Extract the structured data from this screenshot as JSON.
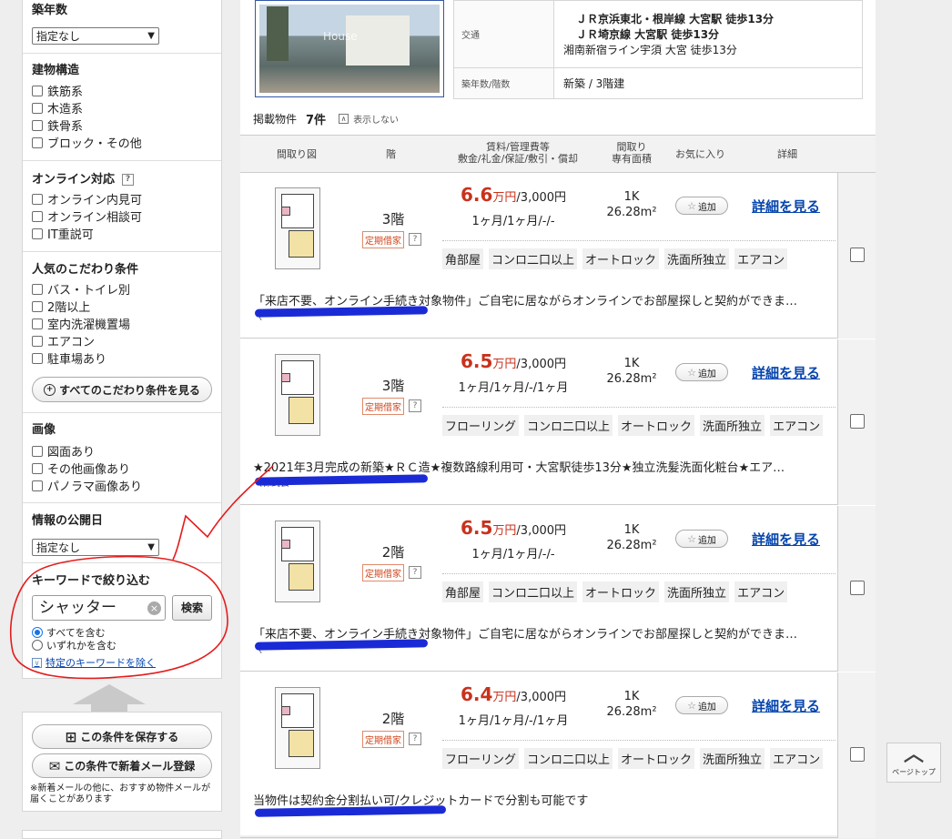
{
  "sidebar": {
    "age": {
      "title": "築年数",
      "select": "指定なし"
    },
    "structure": {
      "title": "建物構造",
      "items": [
        "鉄筋系",
        "木造系",
        "鉄骨系",
        "ブロック・その他"
      ]
    },
    "online": {
      "title": "オンライン対応",
      "help": "?",
      "items": [
        "オンライン内見可",
        "オンライン相談可",
        "IT重説可"
      ]
    },
    "popular": {
      "title": "人気のこだわり条件",
      "items": [
        "バス・トイレ別",
        "2階以上",
        "室内洗濯機置場",
        "エアコン",
        "駐車場あり"
      ],
      "more_button": "すべてのこだわり条件を見る"
    },
    "images": {
      "title": "画像",
      "items": [
        "図面あり",
        "その他画像あり",
        "パノラマ画像あり"
      ]
    },
    "published": {
      "title": "情報の公開日",
      "select": "指定なし"
    },
    "keyword": {
      "title": "キーワードで絞り込む",
      "value": "シャッター",
      "search_button": "検索",
      "radio_all": "すべてを含む",
      "radio_any": "いずれかを含む",
      "exclude_link": "特定のキーワードを除く"
    },
    "save": {
      "save_button": "この条件を保存する",
      "mail_button": "この条件で新着メール登録",
      "note": "※新着メールの他に、おすすめ物件メールが届くことがあります"
    }
  },
  "property": {
    "thumb_watermark": "House",
    "access_label": "交通",
    "access_lines": [
      "ＪＲ京浜東北・根岸線 大宮駅 徒歩13分",
      "ＪＲ埼京線 大宮駅 徒歩13分",
      "湘南新宿ライン宇須 大宮 徒歩13分"
    ],
    "age_label": "築年数/階数",
    "age_value": "新築 / 3階建"
  },
  "listing": {
    "count_label": "掲載物件",
    "count_value": "7件",
    "toggle_label": "表示しない",
    "headers": {
      "floorplan": "間取り図",
      "floor": "階",
      "rent_line1": "賃料/管理費等",
      "rent_line2": "敷金/礼金/保証/敷引・償却",
      "layout_line1": "間取り",
      "layout_line2": "専有面積",
      "favorite": "お気に入り",
      "detail": "詳細"
    },
    "rows": [
      {
        "floor": "3階",
        "tag": "定期借家",
        "rent": "6.6",
        "rent_unit": "万円",
        "mgmt": "/3,000円",
        "deposit": "1ヶ月/1ヶ月/-/-",
        "layout": "1K",
        "area": "26.28m²",
        "fav": "追加",
        "detail": "詳細を見る",
        "features": [
          "角部屋",
          "コンロ二口以上",
          "オートロック",
          "洗面所独立",
          "エアコン"
        ],
        "desc": "「来店不要、オンライン手続き対象物件」ご自宅に居ながらオンラインでお部屋探しと契約ができま…",
        "company": "（"
      },
      {
        "floor": "3階",
        "tag": "定期借家",
        "rent": "6.5",
        "rent_unit": "万円",
        "mgmt": "/3,000円",
        "deposit": "1ヶ月/1ヶ月/-/1ヶ月",
        "layout": "1K",
        "area": "26.28m²",
        "fav": "追加",
        "detail": "詳細を見る",
        "features": [
          "フローリング",
          "コンロ二口以上",
          "オートロック",
          "洗面所独立",
          "エアコン"
        ],
        "desc": "★2021年3月完成の新築★ＲＣ造★複数路線利用可・大宮駅徒歩13分★独立洗髪洗面化粧台★エア…",
        "company": "（株式会"
      },
      {
        "floor": "2階",
        "tag": "定期借家",
        "rent": "6.5",
        "rent_unit": "万円",
        "mgmt": "/3,000円",
        "deposit": "1ヶ月/1ヶ月/-/-",
        "layout": "1K",
        "area": "26.28m²",
        "fav": "追加",
        "detail": "詳細を見る",
        "features": [
          "角部屋",
          "コンロ二口以上",
          "オートロック",
          "洗面所独立",
          "エアコン"
        ],
        "desc": "「来店不要、オンライン手続き対象物件」ご自宅に居ながらオンラインでお部屋探しと契約ができま…",
        "company": "（"
      },
      {
        "floor": "2階",
        "tag": "定期借家",
        "rent": "6.4",
        "rent_unit": "万円",
        "mgmt": "/3,000円",
        "deposit": "1ヶ月/1ヶ月/-/1ヶ月",
        "layout": "1K",
        "area": "26.28m²",
        "fav": "追加",
        "detail": "詳細を見る",
        "features": [
          "フローリング",
          "コンロ二口以上",
          "オートロック",
          "洗面所独立",
          "エアコン"
        ],
        "desc": "当物件は契約金分割払い可/クレジットカードで分割も可能です",
        "company": ""
      }
    ]
  },
  "pagetop": {
    "label": "ページトップ"
  },
  "colors": {
    "price": "#c8321c",
    "link": "#0645ad",
    "annotation": "#e41c1c",
    "redaction": "#1a2bd6"
  },
  "icons": [
    "help-icon",
    "clear-icon",
    "star-icon",
    "save-icon",
    "mail-icon",
    "chevron-up-icon",
    "radio-icon",
    "checkbox-icon"
  ]
}
